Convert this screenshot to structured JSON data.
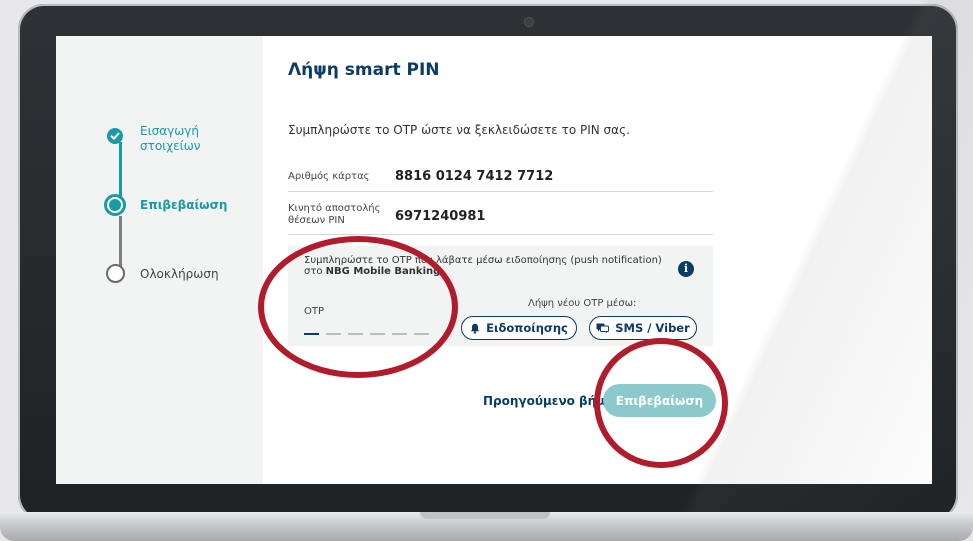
{
  "sidebar": {
    "steps": [
      {
        "label_line1": "Εισαγωγή",
        "label_line2": "στοιχείων",
        "state": "done",
        "icon": "check-icon"
      },
      {
        "label": "Επιβεβαίωση",
        "state": "active"
      },
      {
        "label": "Ολοκλήρωση",
        "state": "pending"
      }
    ]
  },
  "page": {
    "title": "Λήψη smart PIN",
    "instruction": "Συμπληρώστε το OTP ώστε να ξεκλειδώσετε το PIN σας."
  },
  "details": {
    "card_label": "Αριθμός κάρτας",
    "card_value": "8816 0124 7412 7712",
    "mobile_label_line1": "Κινητό αποστολής",
    "mobile_label_line2": "θέσεων PIN",
    "mobile_value": "6971240981"
  },
  "otp": {
    "message_part1": "Συμπληρώστε το OTP που λάβατε μέσω ειδοποίησης (push notification) στο ",
    "message_bold": "NBG Mobile Banking.",
    "field_label": "OTP",
    "digit_count": 6,
    "new_otp_label": "Λήψη νέου OTP μέσω:",
    "notifications_button": "Ειδοποίησης",
    "sms_button": "SMS / Viber"
  },
  "actions": {
    "previous_step": "Προηγούμενο βήμα",
    "confirm": "Επιβεβαίωση"
  },
  "colors": {
    "brand_navy": "#0c3b63",
    "teal": "#1a9aa5",
    "confirm_disabled": "#8cc9cd",
    "annotation_red": "#b01c2b"
  }
}
